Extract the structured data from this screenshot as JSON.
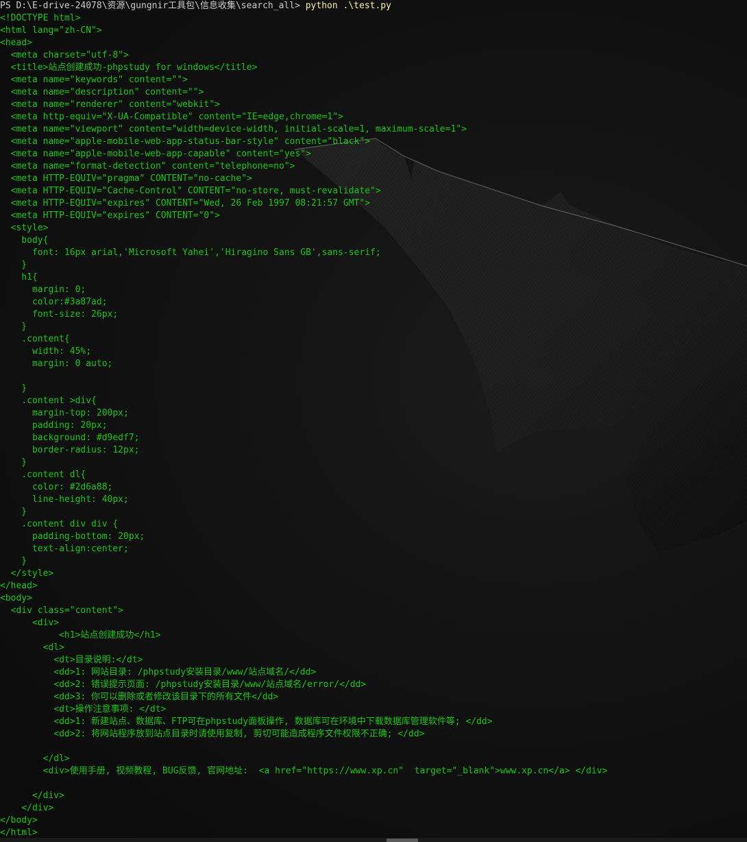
{
  "terminal": {
    "prompt": "PS D:\\E-drive-24078\\资源\\gungnir工具包\\信息收集\\search_all>",
    "command": "python .\\test.py",
    "output_lines": [
      "<!DOCTYPE html>",
      "<html lang=\"zh-CN\">",
      "<head>",
      "  <meta charset=\"utf-8\">",
      "  <title>站点创建成功-phpstudy for windows</title>",
      "  <meta name=\"keywords\" content=\"\">",
      "  <meta name=\"description\" content=\"\">",
      "  <meta name=\"renderer\" content=\"webkit\">",
      "  <meta http-equiv=\"X-UA-Compatible\" content=\"IE=edge,chrome=1\">",
      "  <meta name=\"viewport\" content=\"width=device-width, initial-scale=1, maximum-scale=1\">",
      "  <meta name=\"apple-mobile-web-app-status-bar-style\" content=\"black\">",
      "  <meta name=\"apple-mobile-web-app-capable\" content=\"yes\">",
      "  <meta name=\"format-detection\" content=\"telephone=no\">",
      "  <meta HTTP-EQUIV=\"pragma\" CONTENT=\"no-cache\">",
      "  <meta HTTP-EQUIV=\"Cache-Control\" CONTENT=\"no-store, must-revalidate\">",
      "  <meta HTTP-EQUIV=\"expires\" CONTENT=\"Wed, 26 Feb 1997 08:21:57 GMT\">",
      "  <meta HTTP-EQUIV=\"expires\" CONTENT=\"0\">",
      "  <style>",
      "    body{",
      "      font: 16px arial,'Microsoft Yahei','Hiragino Sans GB',sans-serif;",
      "    }",
      "    h1{",
      "      margin: 0;",
      "      color:#3a87ad;",
      "      font-size: 26px;",
      "    }",
      "    .content{",
      "      width: 45%;",
      "      margin: 0 auto;",
      "",
      "    }",
      "    .content >div{",
      "      margin-top: 200px;",
      "      padding: 20px;",
      "      background: #d9edf7;",
      "      border-radius: 12px;",
      "    }",
      "    .content dl{",
      "      color: #2d6a88;",
      "      line-height: 40px;",
      "    }",
      "    .content div div {",
      "      padding-bottom: 20px;",
      "      text-align:center;",
      "    }",
      "  </style>",
      "</head>",
      "<body>",
      "  <div class=\"content\">",
      "      <div>",
      "           <h1>站点创建成功</h1>",
      "        <dl>",
      "          <dt>目录说明:</dt>",
      "          <dd>1: 网站目录: /phpstudy安装目录/www/站点域名/</dd>",
      "          <dd>2: 错误提示页面: /phpstudy安装目录/www/站点域名/error/</dd>",
      "          <dd>3: 你可以删除或者修改该目录下的所有文件</dd>",
      "          <dt>操作注意事项: </dt>",
      "          <dd>1: 新建站点、数据库、FTP可在phpstudy面板操作, 数据库可在环境中下载数据库管理软件等; </dd>",
      "          <dd>2: 将网站程序放到站点目录时请使用复制, 剪切可能造成程序文件权限不正确; </dd>",
      "",
      "        </dl>",
      "        <div>使用手册, 视频教程, BUG反馈, 官网地址:  <a href=\"https://www.xp.cn\"  target=\"_blank\">www.xp.cn</a> </div>",
      "",
      "      </div>",
      "    </div>",
      "</body>",
      "</html>"
    ]
  },
  "colors": {
    "background": "#0c0c0c",
    "output_text": "#16c60c",
    "prompt_text": "#cccccc",
    "command_text": "#f9f1a5"
  },
  "scrollbar": {
    "position_fraction": 0.54
  }
}
